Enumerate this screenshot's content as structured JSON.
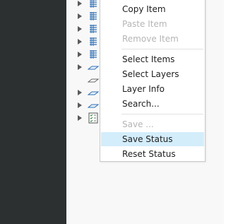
{
  "context_menu": {
    "items": [
      {
        "label": "Copy Item",
        "enabled": true,
        "highlighted": false
      },
      {
        "label": "Paste Item",
        "enabled": false,
        "highlighted": false
      },
      {
        "label": "Remove Item",
        "enabled": false,
        "highlighted": false
      },
      {
        "label": "Select Items",
        "enabled": true,
        "highlighted": false
      },
      {
        "label": "Select Layers",
        "enabled": true,
        "highlighted": false
      },
      {
        "label": "Layer Info",
        "enabled": true,
        "highlighted": false
      },
      {
        "label": "Search...",
        "enabled": true,
        "highlighted": false
      },
      {
        "label": "Save ...",
        "enabled": false,
        "highlighted": false
      },
      {
        "label": "Save Status",
        "enabled": true,
        "highlighted": true
      },
      {
        "label": "Reset Status",
        "enabled": true,
        "highlighted": false
      }
    ]
  },
  "tree": {
    "rows": [
      {
        "icon": "feature-layer-icon"
      },
      {
        "icon": "feature-layer-icon"
      },
      {
        "icon": "feature-layer-icon"
      },
      {
        "icon": "feature-layer-icon"
      },
      {
        "icon": "feature-layer-icon"
      },
      {
        "icon": "plane-icon"
      },
      {
        "icon": "plane-icon"
      },
      {
        "icon": "plane-icon"
      },
      {
        "icon": "plane-icon"
      },
      {
        "icon": "checklist-icon"
      }
    ]
  },
  "colors": {
    "left_panel": "#2d3030",
    "tree_background": "#f8f8f8",
    "highlight": "#d3edfb",
    "disabled_text": "#b5b5b5",
    "icon_blue": "#2f6fb5"
  }
}
